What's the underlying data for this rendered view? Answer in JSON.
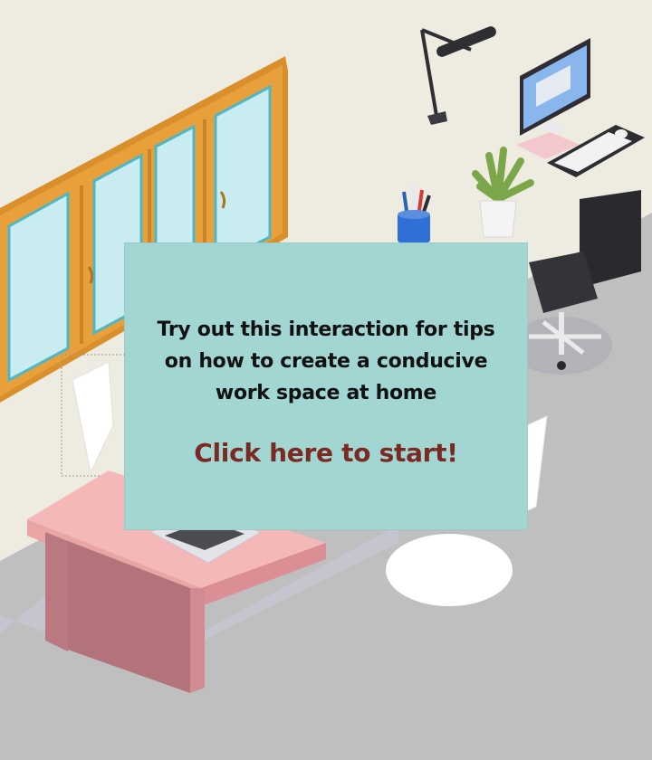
{
  "dialog": {
    "message_line1": "Try out this interaction for tips",
    "message_line2": "on how to create a conducive",
    "message_line3": "work space at home",
    "start_label": "Click here to start!"
  },
  "colors": {
    "wall": "#eeece0",
    "floor": "#bfbfbf",
    "dialog_bg": "#a2d6d3",
    "start_text": "#7a2a22",
    "window_frame": "#e0962e",
    "desk": "#f2b6b6",
    "chair": "#2a2a2e"
  },
  "icons": {
    "lamp": "desk-lamp-icon",
    "monitor": "desktop-monitor-icon",
    "keyboard": "keyboard-icon",
    "plant": "potted-plant-icon",
    "pens": "pen-cup-icon",
    "chair": "office-chair-icon",
    "laptop": "laptop-icon"
  }
}
